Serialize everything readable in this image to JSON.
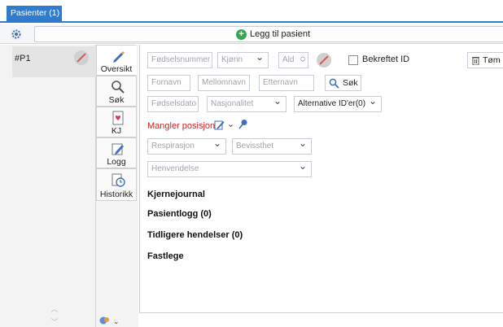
{
  "window_tab": {
    "label": "Pasienter (1)"
  },
  "toolbar": {
    "add_patient_label": "Legg til pasient"
  },
  "patients": [
    {
      "id": "#P1"
    }
  ],
  "side_tabs": [
    {
      "label": "Oversikt",
      "icon": "pencil-icon"
    },
    {
      "label": "Søk",
      "icon": "search-icon"
    },
    {
      "label": "KJ",
      "icon": "heart-document-icon"
    },
    {
      "label": "Logg",
      "icon": "log-edit-icon"
    },
    {
      "label": "Historikk",
      "icon": "history-icon"
    }
  ],
  "form": {
    "fodselsnummer": {
      "placeholder": "Fødselsnummer"
    },
    "kjonn": {
      "value": "Kjønn"
    },
    "alder": {
      "value": "Ald"
    },
    "bekreftet_id_label": "Bekreftet ID",
    "tom_label": "Tøm",
    "fornavn": {
      "placeholder": "Fornavn"
    },
    "mellomnavn": {
      "placeholder": "Mellomnavn"
    },
    "etternavn": {
      "placeholder": "Etternavn"
    },
    "sok_label": "Søk",
    "fodselsdato": {
      "placeholder": "Fødselsdato"
    },
    "nasjonalitet": {
      "value": "Nasjonalitet"
    },
    "alt_ids": {
      "value": "Alternative ID'er(0)"
    },
    "position_missing": "Mangler posisjon",
    "respirasjon": {
      "value": "Respirasjon"
    },
    "bevissthet": {
      "value": "Bevissthet"
    },
    "henvendelse": {
      "value": "Henvendelse"
    }
  },
  "sections": {
    "kjernejournal": "Kjernejournal",
    "pasientlogg": "Pasientlogg (0)",
    "tidligere_hendelser": "Tidligere hendelser (0)",
    "fastlege": "Fastlege"
  },
  "colors": {
    "accent": "#2e7bcf",
    "warning": "#d02020",
    "add_green": "#3aa655"
  }
}
